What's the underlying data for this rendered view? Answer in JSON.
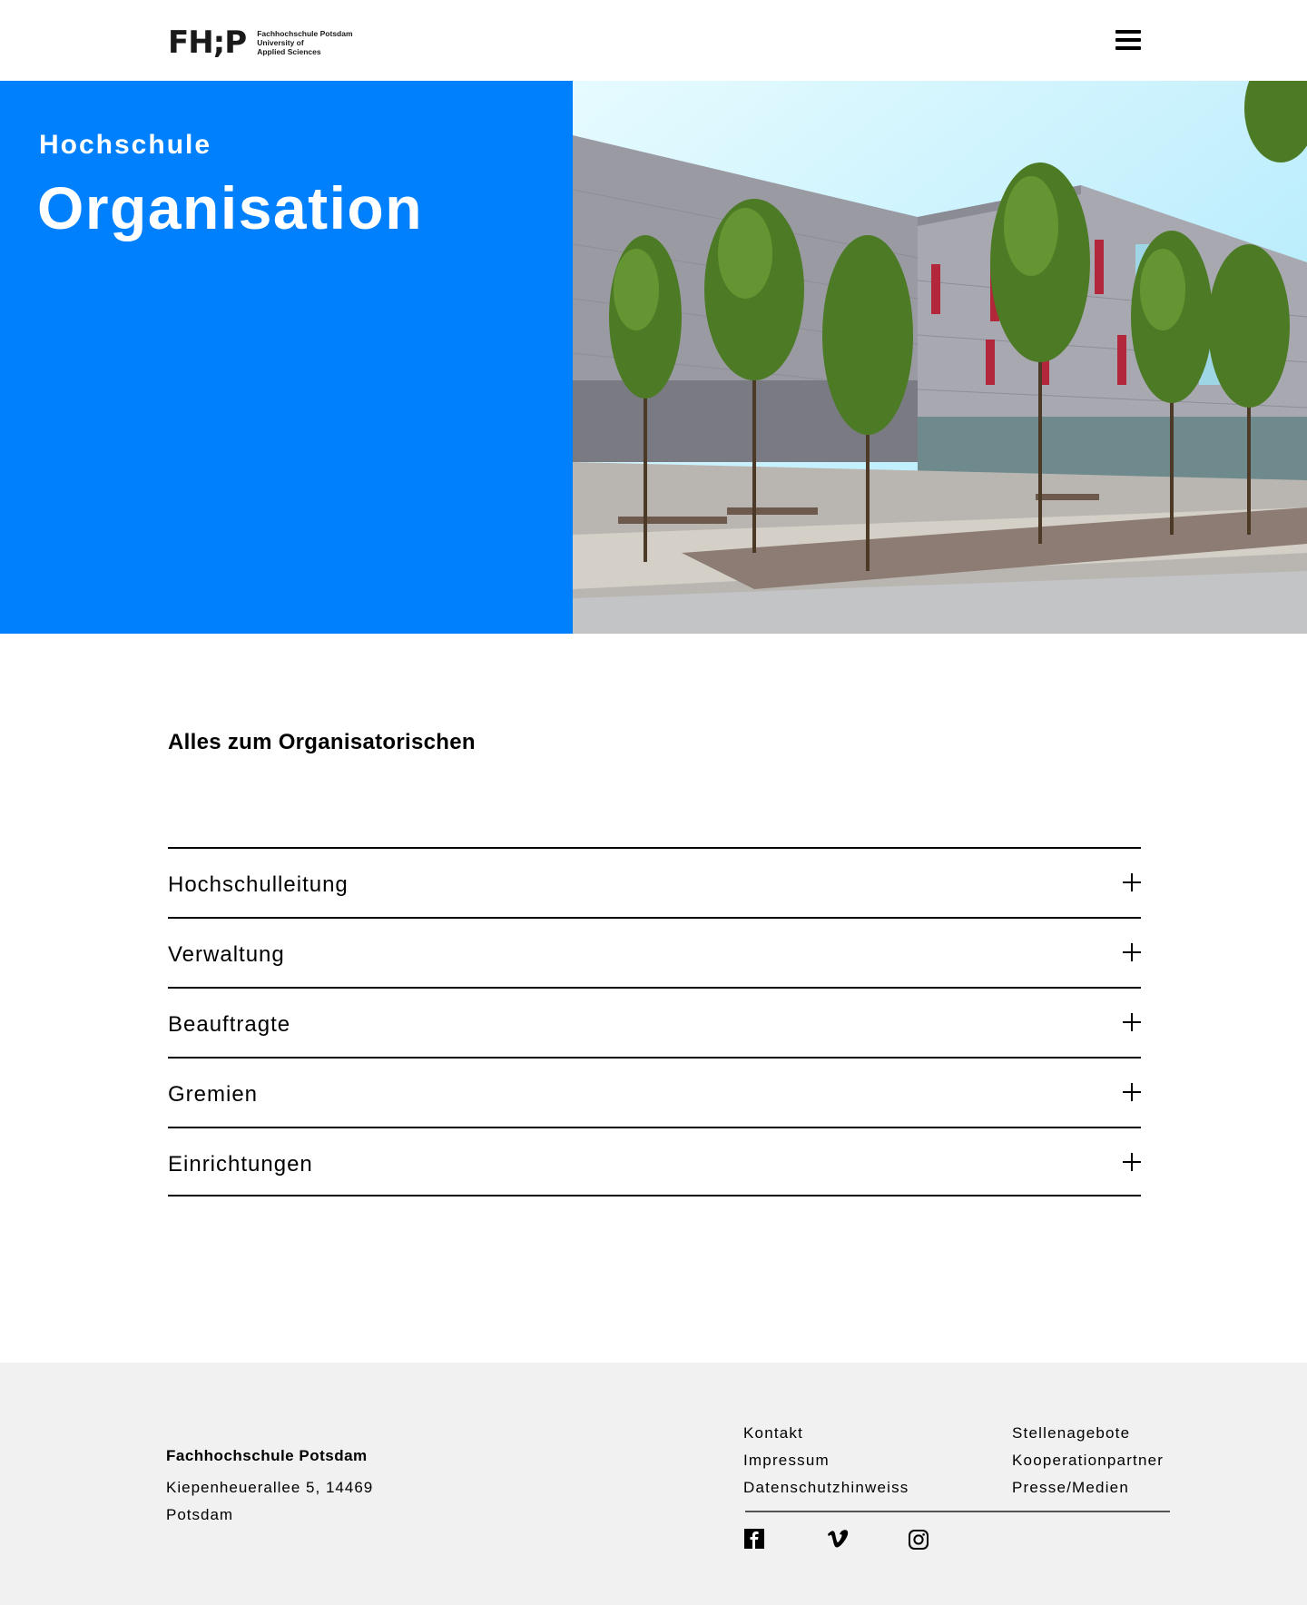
{
  "header": {
    "logo_mark": "FH;P",
    "logo_lines": [
      "Fachhochschule Potsdam",
      "University of",
      "Applied Sciences"
    ]
  },
  "hero": {
    "kicker": "Hochschule",
    "title": "Organisation",
    "accent_color": "#0080fc"
  },
  "main": {
    "heading": "Alles zum Organisatorischen",
    "accordion": [
      {
        "label": "Hochschulleitung"
      },
      {
        "label": "Verwaltung"
      },
      {
        "label": "Beauftragte"
      },
      {
        "label": "Gremien"
      },
      {
        "label": "Einrichtungen"
      }
    ]
  },
  "footer": {
    "name": "Fachhochschule Potsdam",
    "address": "Kiepenheuerallee 5, 14469 Potsdam",
    "links_col1": [
      "Kontakt",
      "Impressum",
      "Datenschutzhinweiss"
    ],
    "links_col2": [
      "Stellenagebote",
      "Kooperationpartner",
      "Presse/Medien"
    ],
    "social": [
      "facebook-icon",
      "vimeo-icon",
      "instagram-icon"
    ],
    "background": "#f2f1f2"
  }
}
